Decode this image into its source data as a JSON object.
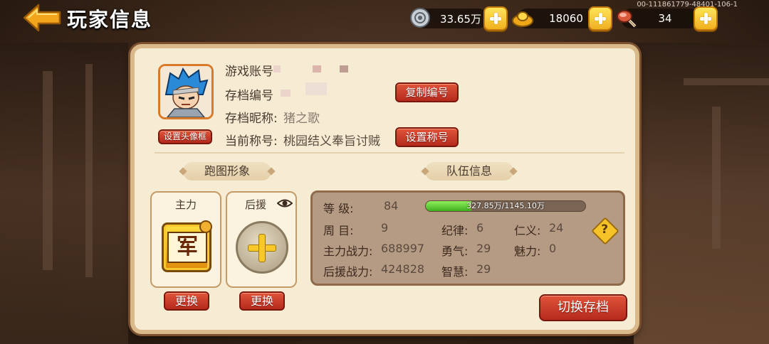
{
  "header": {
    "title": "玩家信息",
    "build_id": "00-111861779-48401-106-1"
  },
  "resources": [
    {
      "icon": "silver-coin-icon",
      "value": "33.65万"
    },
    {
      "icon": "gold-ingot-icon",
      "value": "18060"
    },
    {
      "icon": "meat-drumstick-icon",
      "value": "34"
    }
  ],
  "profile": {
    "account_label": "游戏账号",
    "save_id_label": "存档编号",
    "nickname_label": "存档昵称:",
    "nickname_value": "猪之歌",
    "title_label": "当前称号:",
    "title_value": "桃园结义奉旨讨贼",
    "copy_id_button": "复制编号",
    "set_title_button": "设置称号",
    "set_avatar_frame_button": "设置头像框"
  },
  "sections": {
    "run_image": "跑图形象",
    "team_info": "队伍信息"
  },
  "cards": {
    "main_title": "主力",
    "main_badge": "军",
    "support_title": "后援",
    "change_button": "更换"
  },
  "team": {
    "level_label": "等    级:",
    "level_value": "84",
    "xp_text": "327.85万/1145.10万",
    "xp_fraction": 0.2863,
    "cycle_label": "周    目:",
    "cycle_value": "9",
    "discipline_label": "纪律:",
    "discipline_value": "6",
    "benevolence_label": "仁义:",
    "benevolence_value": "24",
    "main_power_label": "主力战力:",
    "main_power_value": "688997",
    "courage_label": "勇气:",
    "courage_value": "29",
    "charm_label": "魅力:",
    "charm_value": "0",
    "support_power_label": "后援战力:",
    "support_power_value": "424828",
    "wisdom_label": "智慧:",
    "wisdom_value": "29"
  },
  "switch_save_button": "切换存档",
  "colors": {
    "panel_bg": "#f6ecd4",
    "button_red": "#c0341f",
    "accent_gold": "#f5c328",
    "xp_green": "#4fc02a"
  }
}
